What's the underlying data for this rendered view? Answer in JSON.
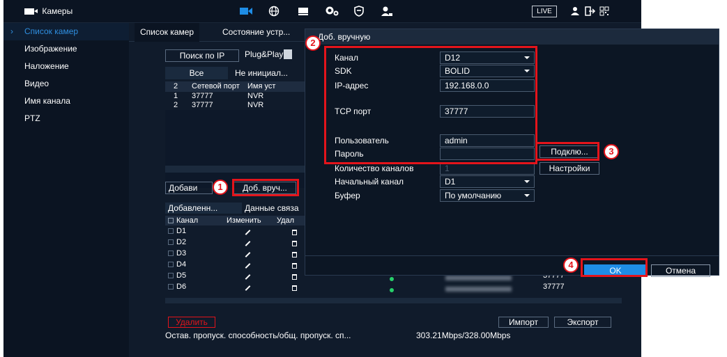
{
  "topbar": {
    "brand_label": "Камеры",
    "live_label": "LIVE",
    "icons": [
      "camera-icon",
      "network-icon",
      "storage-icon",
      "settings-icon",
      "security-icon",
      "account-icon",
      "user-icon",
      "logout-icon",
      "qr-icon"
    ]
  },
  "sidebar": {
    "items": [
      {
        "label": "Список камер",
        "active": true
      },
      {
        "label": "Изображение"
      },
      {
        "label": "Наложение"
      },
      {
        "label": "Видео"
      },
      {
        "label": "Имя канала"
      },
      {
        "label": "PTZ"
      }
    ]
  },
  "main": {
    "tabs": [
      "Список камер",
      "Состояние устр..."
    ],
    "search_ip_label": "Поиск по IP",
    "plug_play_label": "Plug&Play",
    "filter_all": "Все",
    "filter_uninit": "Не инициал...",
    "found_table": {
      "headers": [
        "2",
        "Сетевой порт",
        "Имя уст"
      ],
      "rows": [
        [
          "1",
          "37777",
          "NVR"
        ],
        [
          "2",
          "37777",
          "NVR"
        ]
      ]
    },
    "add_label": "Добави",
    "manual_add_label": "Доб. вруч...",
    "added_tab": "Добавленн...",
    "link_data_tab": "Данные связа",
    "added_table": {
      "headers": [
        "Канал",
        "Изменить",
        "Удал"
      ],
      "rows": [
        {
          "channel": "D1"
        },
        {
          "channel": "D2"
        },
        {
          "channel": "D3"
        },
        {
          "channel": "D4"
        },
        {
          "channel": "D5",
          "port": "37777"
        },
        {
          "channel": "D6",
          "port": "37777"
        }
      ]
    },
    "delete_label": "Удалить",
    "import_label": "Импорт",
    "export_label": "Экспорт",
    "bandwidth_label": "Остав. пропуск. способность/общ. пропуск. сп...",
    "bandwidth_value": "303.21Mbps/328.00Mbps"
  },
  "dialog": {
    "title": "Доб. вручную",
    "fields": {
      "channel_label": "Канал",
      "channel_value": "D12",
      "sdk_label": "SDK",
      "sdk_value": "BOLID",
      "ip_label": "IP-адрес",
      "ip_value": "192.168.0.0",
      "tcp_label": "TCP порт",
      "tcp_value": "37777",
      "user_label": "Пользователь",
      "user_value": "admin",
      "password_label": "Пароль",
      "password_value": "",
      "channels_count_label": "Количество каналов",
      "channels_count_value": "1",
      "start_channel_label": "Начальный канал",
      "start_channel_value": "D1",
      "buffer_label": "Буфер",
      "buffer_value": "По умолчанию"
    },
    "connect_label": "Подклю...",
    "settings_label": "Настройки",
    "ok_label": "OK",
    "cancel_label": "Отмена"
  },
  "annotations": {
    "badges": [
      "1",
      "2",
      "3",
      "4"
    ],
    "color": "#e4141b"
  },
  "colors": {
    "accent": "#1e8de6",
    "background": "#0c1727",
    "status_online": "#27d06a"
  }
}
